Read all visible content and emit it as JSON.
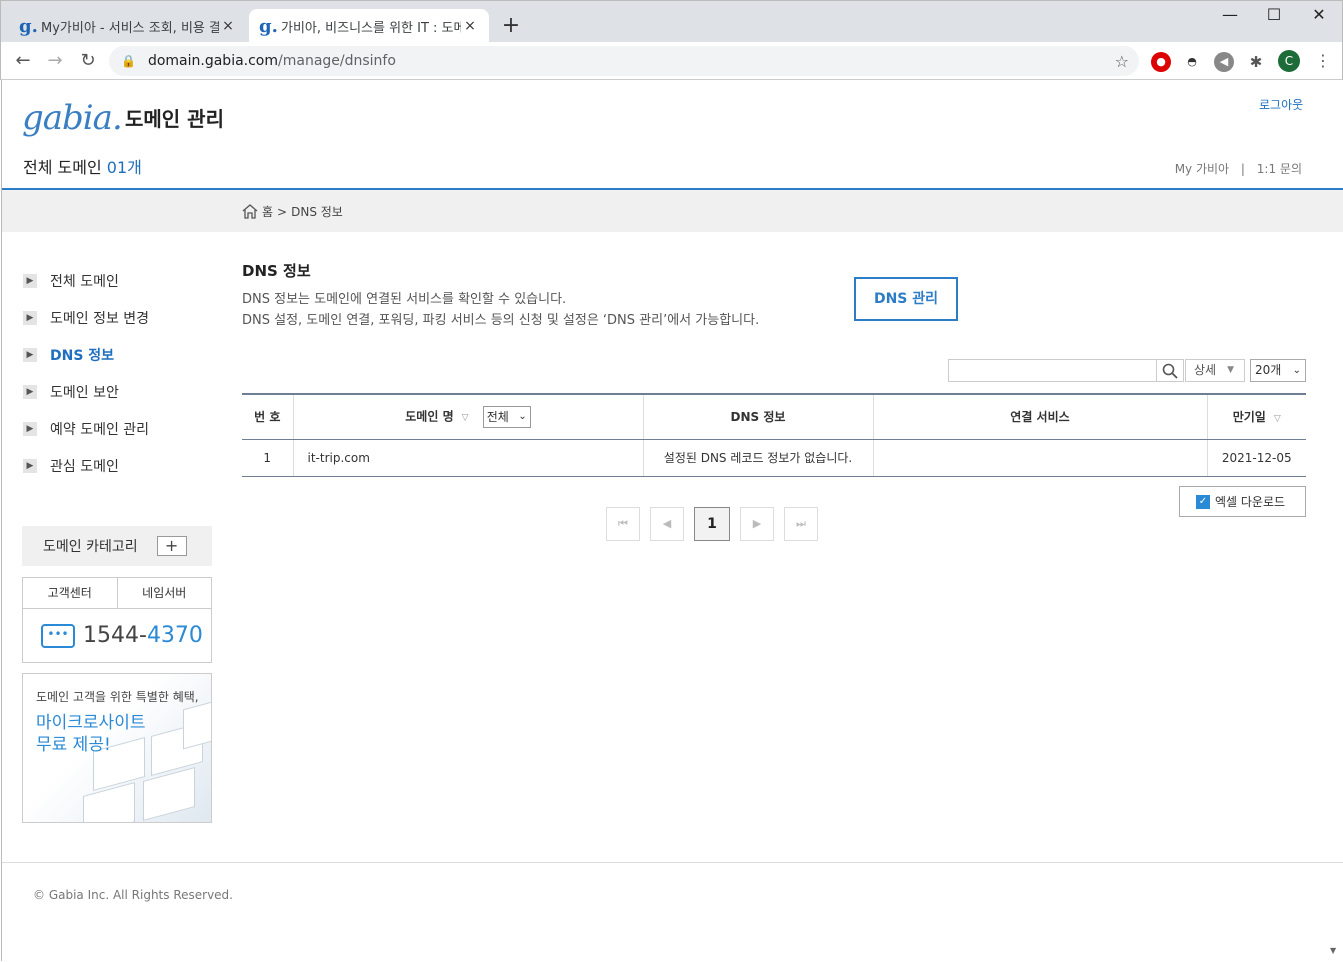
{
  "browser": {
    "tabs": [
      {
        "favicon": "g.",
        "title": "My가비아 - 서비스 조회, 비용 결",
        "close": "×"
      },
      {
        "favicon": "g.",
        "title": "가비아, 비즈니스를 위한 IT : 도메",
        "close": "×"
      }
    ],
    "new_tab": "+",
    "window_controls": {
      "minimize": "—",
      "maximize": "☐",
      "close": "✕"
    },
    "nav": {
      "back": "←",
      "forward": "→",
      "reload": "↻"
    },
    "url_host": "domain.gabia.com",
    "url_path": "/manage/dnsinfo",
    "profile_initial": "C"
  },
  "header": {
    "logo": "gabia.",
    "title": "도메인 관리",
    "logout": "로그아웃",
    "all_domain_label": "전체 도메인",
    "all_domain_count": "01개",
    "links": [
      "My 가비아",
      "|",
      "1:1 문의"
    ]
  },
  "breadcrumb": {
    "home": "홈",
    "separator": ">",
    "current": "DNS 정보"
  },
  "sidebar": {
    "items": [
      {
        "label": "전체 도메인",
        "active": false
      },
      {
        "label": "도메인 정보 변경",
        "active": false
      },
      {
        "label": "DNS 정보",
        "active": true
      },
      {
        "label": "도메인 보안",
        "active": false
      },
      {
        "label": "예약 도메인 관리",
        "active": false
      },
      {
        "label": "관심 도메인",
        "active": false
      }
    ],
    "category_label": "도메인 카테고리",
    "category_add": "+",
    "cs_tabs": [
      "고객센터",
      "네임서버"
    ],
    "phone_prefix": "1544-",
    "phone_suffix": "4370",
    "banner_line1": "도메인 고객을 위한 특별한 혜택,",
    "banner_line2": "마이크로사이트",
    "banner_line3": "무료 제공!"
  },
  "main": {
    "title": "DNS 정보",
    "desc1": "DNS 정보는 도메인에 연결된 서비스를 확인할 수 있습니다.",
    "desc2": "DNS 설정, 도메인 연결, 포워딩, 파킹 서비스 등의 신청 및 설정은 ‘DNS 관리’에서 가능합니다.",
    "dns_manage_button": "DNS 관리",
    "search_placeholder": "",
    "detail_label": "상세",
    "per_page": "20개",
    "table": {
      "headers": [
        "번 호",
        "도메인 명",
        "DNS 정보",
        "연결 서비스",
        "만기일"
      ],
      "filter_value": "전체",
      "rows": [
        {
          "no": "1",
          "domain": "it-trip.com",
          "dns": "설정된 DNS 레코드 정보가 없습니다.",
          "service": "",
          "expiry": "2021-12-05"
        }
      ]
    },
    "excel_button": "엑셀 다운로드",
    "pagination": {
      "first": "⏮",
      "prev": "◀",
      "current": "1",
      "next": "▶",
      "last": "⏭"
    }
  },
  "footer": {
    "copyright": "© Gabia Inc. All Rights Reserved."
  },
  "colors": {
    "accent": "#2c7cc7",
    "link": "#1e6fbf"
  }
}
